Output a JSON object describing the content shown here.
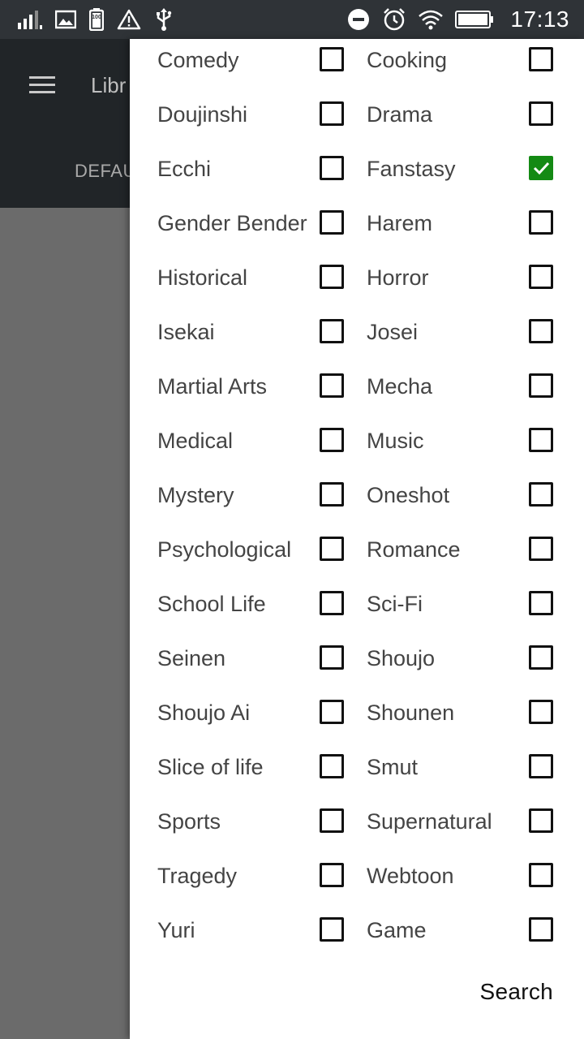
{
  "status_bar": {
    "time": "17:13",
    "battery_text": "100",
    "icons": [
      "signal-icon",
      "image-icon",
      "battery-icon",
      "warning-icon",
      "usb-icon",
      "do-not-disturb-icon",
      "alarm-icon",
      "wifi-icon",
      "battery-full-icon"
    ]
  },
  "app": {
    "title": "Libr",
    "tab": "DEFAU"
  },
  "genres": [
    [
      {
        "label": "Comedy",
        "checked": false
      },
      {
        "label": "Cooking",
        "checked": false
      }
    ],
    [
      {
        "label": "Doujinshi",
        "checked": false
      },
      {
        "label": "Drama",
        "checked": false
      }
    ],
    [
      {
        "label": "Ecchi",
        "checked": false
      },
      {
        "label": "Fanstasy",
        "checked": true
      }
    ],
    [
      {
        "label": "Gender Bender",
        "checked": false
      },
      {
        "label": "Harem",
        "checked": false
      }
    ],
    [
      {
        "label": "Historical",
        "checked": false
      },
      {
        "label": "Horror",
        "checked": false
      }
    ],
    [
      {
        "label": "Isekai",
        "checked": false
      },
      {
        "label": "Josei",
        "checked": false
      }
    ],
    [
      {
        "label": "Martial Arts",
        "checked": false
      },
      {
        "label": "Mecha",
        "checked": false
      }
    ],
    [
      {
        "label": "Medical",
        "checked": false
      },
      {
        "label": "Music",
        "checked": false
      }
    ],
    [
      {
        "label": "Mystery",
        "checked": false
      },
      {
        "label": "Oneshot",
        "checked": false
      }
    ],
    [
      {
        "label": "Psychological",
        "checked": false
      },
      {
        "label": "Romance",
        "checked": false
      }
    ],
    [
      {
        "label": "School Life",
        "checked": false
      },
      {
        "label": "Sci-Fi",
        "checked": false
      }
    ],
    [
      {
        "label": "Seinen",
        "checked": false
      },
      {
        "label": "Shoujo",
        "checked": false
      }
    ],
    [
      {
        "label": "Shoujo Ai",
        "checked": false
      },
      {
        "label": "Shounen",
        "checked": false
      }
    ],
    [
      {
        "label": "Slice of life",
        "checked": false
      },
      {
        "label": "Smut",
        "checked": false
      }
    ],
    [
      {
        "label": "Sports",
        "checked": false
      },
      {
        "label": "Supernatural",
        "checked": false
      }
    ],
    [
      {
        "label": "Tragedy",
        "checked": false
      },
      {
        "label": "Webtoon",
        "checked": false
      }
    ],
    [
      {
        "label": "Yuri",
        "checked": false
      },
      {
        "label": "Game",
        "checked": false
      }
    ]
  ],
  "search_label": "Search",
  "colors": {
    "checked": "#148a14",
    "status_bar": "#2f3337",
    "app_bar": "#212528",
    "scrim": "#6b6b6b"
  }
}
